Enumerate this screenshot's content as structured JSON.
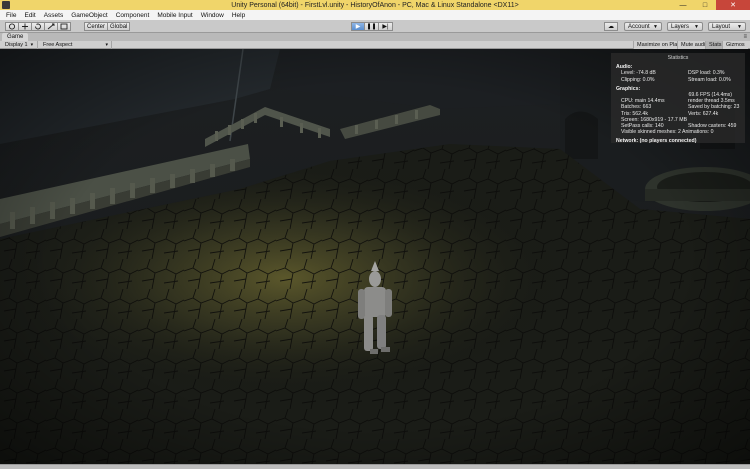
{
  "window": {
    "title": "Unity Personal (64bit) - FirstLvl.unity - HistoryOfAnon - PC, Mac & Linux Standalone <DX11>",
    "controls": {
      "minimize": "—",
      "maximize": "□",
      "close": "✕"
    }
  },
  "menu": [
    "File",
    "Edit",
    "Assets",
    "GameObject",
    "Component",
    "Mobile Input",
    "Window",
    "Help"
  ],
  "toolbar": {
    "tools": [
      "hand-tool",
      "move-tool",
      "rotate-tool",
      "scale-tool",
      "rect-tool"
    ],
    "pivot_label": "Center",
    "space_label": "Global",
    "play": {
      "play_icon": "▶",
      "pause_icon": "❚❚",
      "step_icon": "▶|",
      "playing": true
    },
    "account_label": "Account",
    "layers_label": "Layers",
    "layout_label": "Layout",
    "cloud_icon": "☁"
  },
  "tab": {
    "label": "Game"
  },
  "gamebar": {
    "display": "Display 1",
    "aspect": "Free Aspect",
    "maximize_on_play": "Maximize on Play",
    "mute_audio": "Mute audio",
    "stats": "Stats",
    "gizmos": "Gizmos"
  },
  "stats": {
    "title": "Statistics",
    "audio_label": "Audio:",
    "audio": [
      [
        "Level: -74.8 dB",
        "DSP load: 0.3%"
      ],
      [
        "Clipping: 0.0%",
        "Stream load: 0.0%"
      ]
    ],
    "graphics_label": "Graphics:",
    "fps": "69.6 FPS (14.4ms)",
    "graphics": [
      [
        "CPU: main 14.4ms",
        "render thread 3.5ms"
      ],
      [
        "Batches: 663",
        "Saved by batching: 23"
      ],
      [
        "Tris: 562.4k",
        "Verts: 627.4k"
      ],
      [
        "Screen: 1680x919 - 17.7 MB",
        ""
      ],
      [
        "SetPass calls: 140",
        "Shadow casters: 459"
      ]
    ],
    "visible_skinned": "Visible skinned meshes: 2  Animations: 0",
    "network": "Network: (no players connected)"
  }
}
